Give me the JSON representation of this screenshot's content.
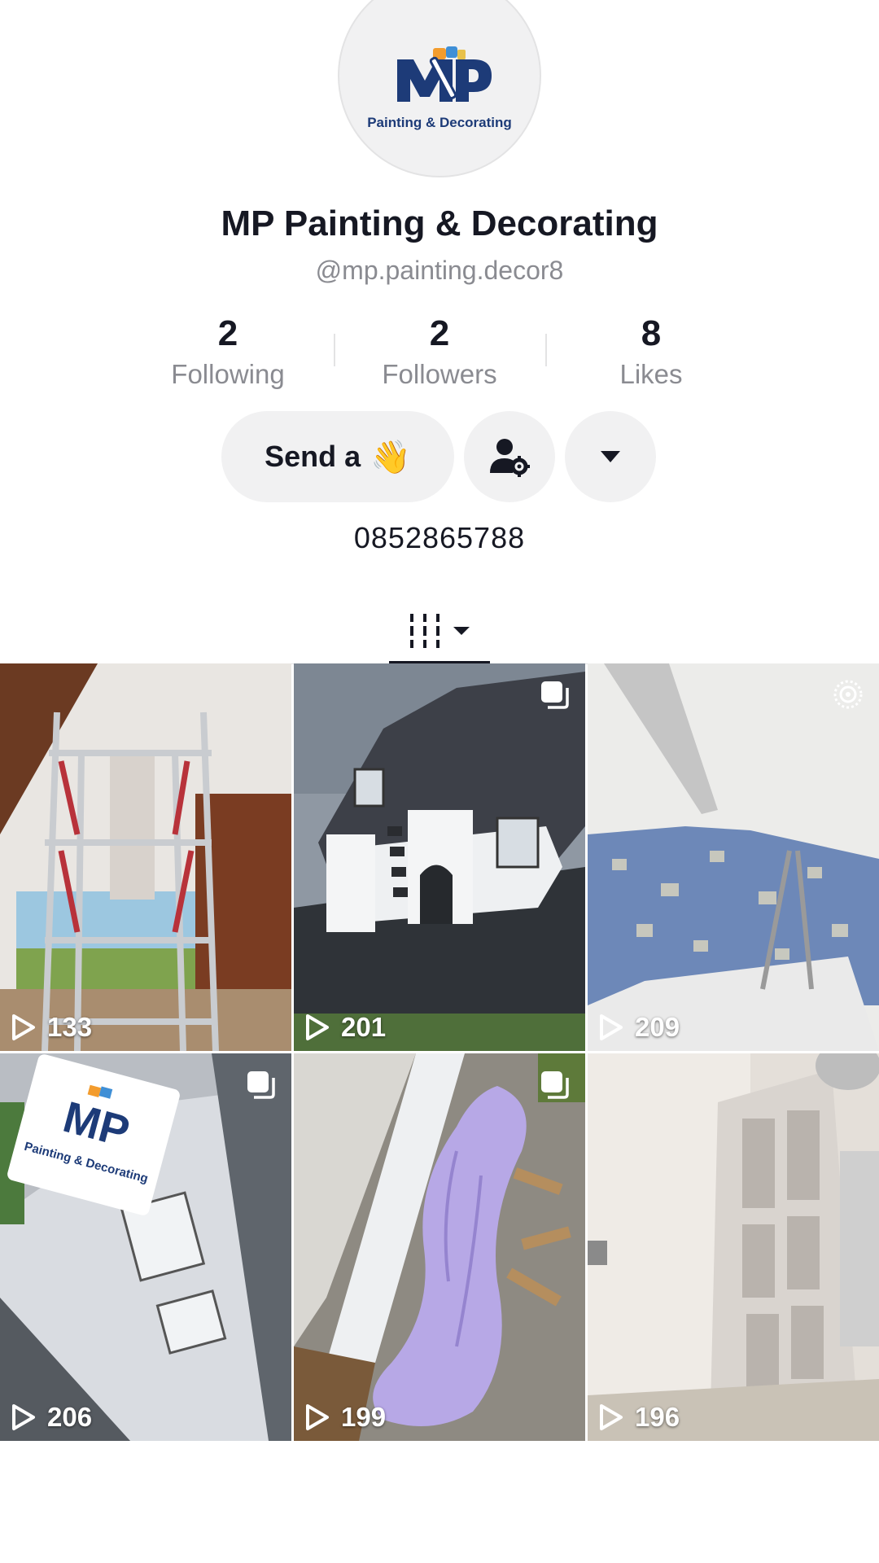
{
  "profile": {
    "logo_text": "MP",
    "logo_tagline": "Painting & Decorating",
    "display_name": "MP Painting & Decorating",
    "username": "@mp.painting.decor8",
    "phone": "0852865788"
  },
  "stats": [
    {
      "value": "2",
      "label": "Following"
    },
    {
      "value": "2",
      "label": "Followers"
    },
    {
      "value": "8",
      "label": "Likes"
    }
  ],
  "actions": {
    "send_label": "Send a",
    "send_emoji": "👋"
  },
  "icons": {
    "profile_settings": "person-gear-icon",
    "more": "caret-down-icon",
    "videos_tab": "grid-bars-icon",
    "view_count": "play-icon",
    "multi_photo": "stack-icon",
    "live_photo": "target-circle-icon"
  },
  "videos": [
    {
      "views": "133",
      "badge": ""
    },
    {
      "views": "201",
      "badge": "stack"
    },
    {
      "views": "209",
      "badge": "target"
    },
    {
      "views": "206",
      "badge": "stack"
    },
    {
      "views": "199",
      "badge": "stack"
    },
    {
      "views": "196",
      "badge": ""
    }
  ],
  "colors": {
    "text": "#161823",
    "secondary": "#8a8b91",
    "button_bg": "#f1f1f2",
    "logo_navy": "#1d3b78",
    "logo_orange": "#f39c2d",
    "logo_blue": "#3f8fd6"
  }
}
